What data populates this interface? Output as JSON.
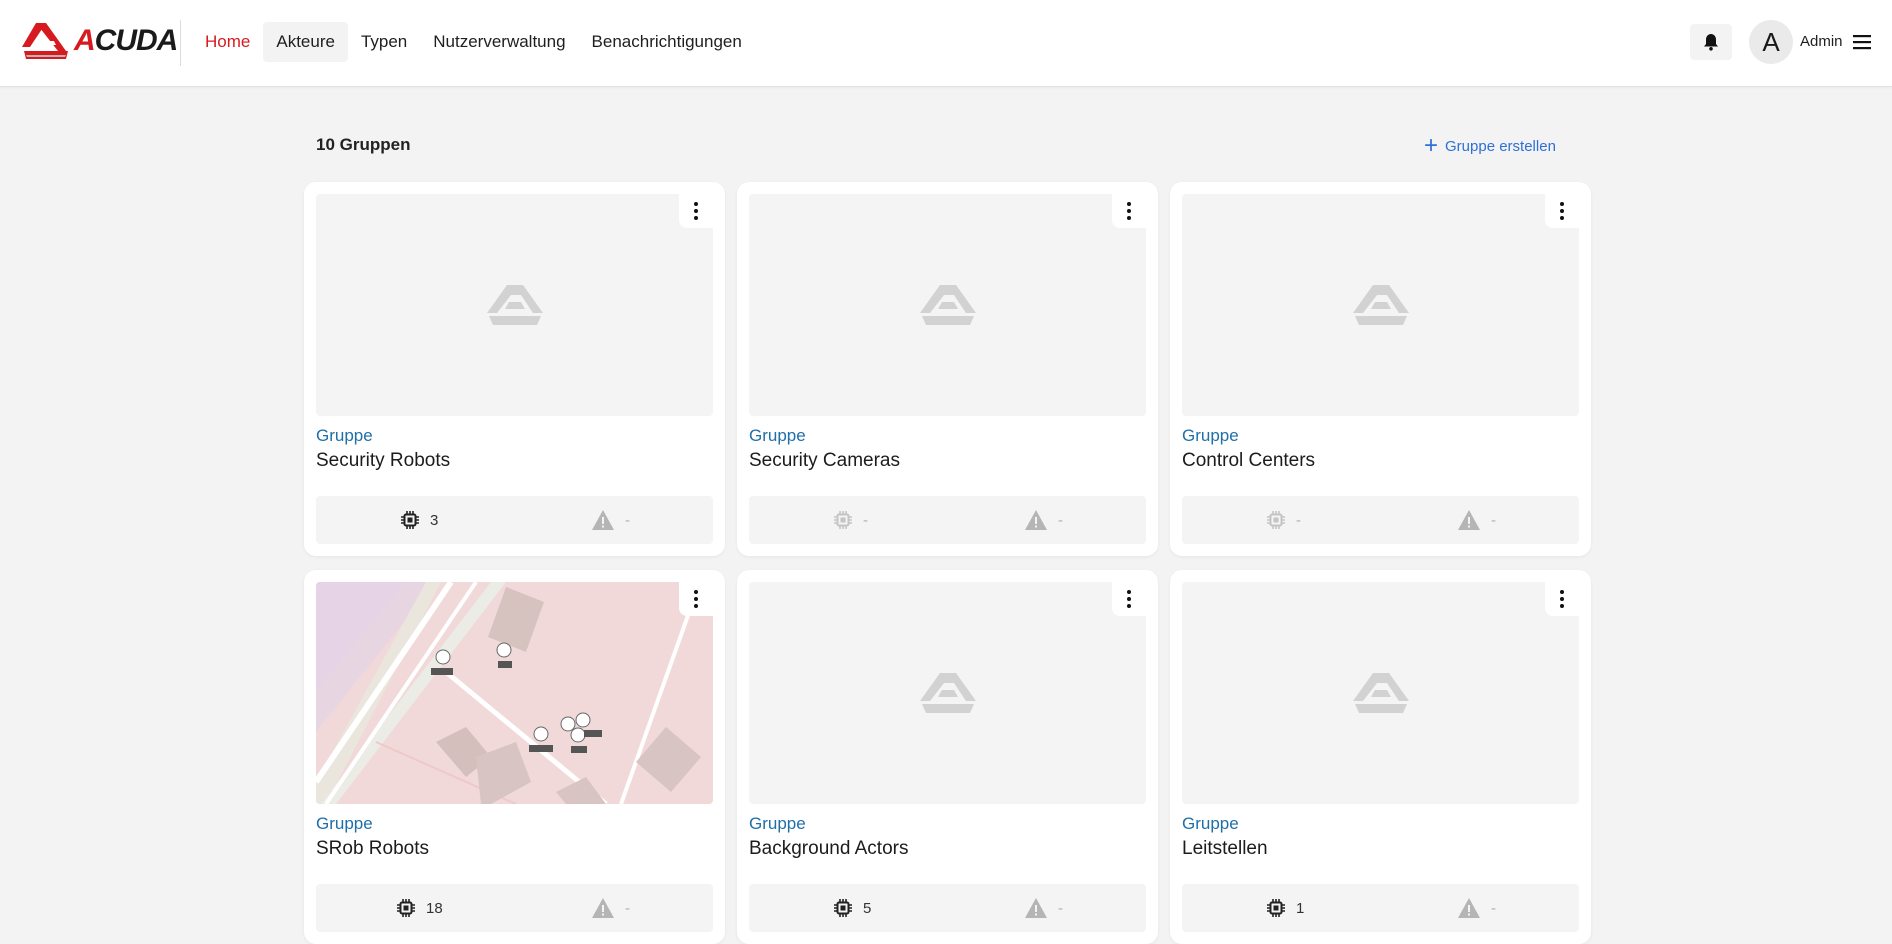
{
  "header": {
    "logo_text": "ACUDA",
    "nav": [
      {
        "label": "Home",
        "active": true
      },
      {
        "label": "Akteure",
        "active": false
      },
      {
        "label": "Typen",
        "active": false
      },
      {
        "label": "Nutzerverwaltung",
        "active": false
      },
      {
        "label": "Benachrichtigungen",
        "active": false
      }
    ],
    "user": {
      "initial": "A",
      "name": "Admin"
    }
  },
  "content": {
    "group_count": "10 Gruppen",
    "create_label": "Gruppe erstellen",
    "cards": [
      {
        "type": "Gruppe",
        "name": "Security Robots",
        "actors": "3",
        "alerts": "-",
        "thumb": "placeholder"
      },
      {
        "type": "Gruppe",
        "name": "Security Cameras",
        "actors": "-",
        "alerts": "-",
        "thumb": "placeholder"
      },
      {
        "type": "Gruppe",
        "name": "Control Centers",
        "actors": "-",
        "alerts": "-",
        "thumb": "placeholder"
      },
      {
        "type": "Gruppe",
        "name": "SRob Robots",
        "actors": "18",
        "alerts": "-",
        "thumb": "map"
      },
      {
        "type": "Gruppe",
        "name": "Background Actors",
        "actors": "5",
        "alerts": "-",
        "thumb": "placeholder"
      },
      {
        "type": "Gruppe",
        "name": "Leitstellen",
        "actors": "1",
        "alerts": "-",
        "thumb": "placeholder"
      }
    ]
  },
  "colors": {
    "brand_red": "#d71920",
    "link_blue": "#2f6fd6",
    "type_blue": "#1f6fa8",
    "background": "#f3f3f3"
  },
  "icons": [
    "acuda-logo",
    "bell-icon",
    "hamburger-menu-icon",
    "plus-icon",
    "kebab-menu-icon",
    "acuda-placeholder-icon",
    "chip-icon",
    "warning-icon"
  ]
}
